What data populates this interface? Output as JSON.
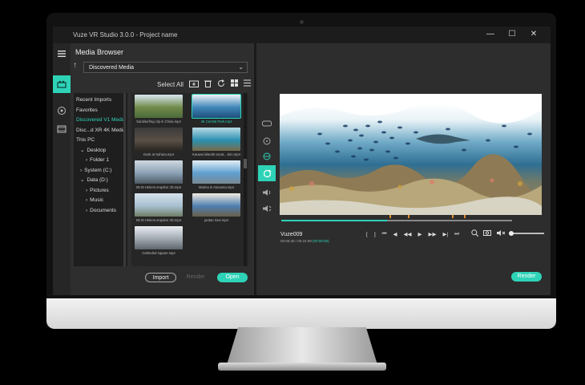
{
  "window": {
    "title": "Vuze VR Studio 3.0.0 - Project name",
    "controls": {
      "minimize": "—",
      "maximize": "☐",
      "close": "✕"
    }
  },
  "media_browser": {
    "title": "Media Browser",
    "source_select": "Discovered Media",
    "select_all": "Select All",
    "tree": [
      {
        "label": "Recent Imports",
        "level": 0,
        "selected": false
      },
      {
        "label": "Favorites",
        "level": 0,
        "selected": false
      },
      {
        "label": "Discovered V1 Media",
        "level": 0,
        "selected": true
      },
      {
        "label": "Disc...d XR 4K Media",
        "level": 0,
        "selected": false
      },
      {
        "label": "This PC",
        "level": 0,
        "selected": false
      },
      {
        "label": "Desktop",
        "level": 1,
        "selected": false,
        "toggle": "⌄"
      },
      {
        "label": "Folder 1",
        "level": 2,
        "selected": false,
        "toggle": "›"
      },
      {
        "label": "System (C:)",
        "level": 1,
        "selected": false,
        "toggle": "›"
      },
      {
        "label": "Data (D:)",
        "level": 1,
        "selected": false,
        "toggle": "⌄"
      },
      {
        "label": "Pictures",
        "level": 2,
        "selected": false,
        "toggle": "›"
      },
      {
        "label": "Music",
        "level": 2,
        "selected": false,
        "toggle": "›"
      },
      {
        "label": "Documents",
        "level": 2,
        "selected": false,
        "toggle": "›"
      }
    ],
    "thumbnails": [
      {
        "caption": "Sandsurfing city in China.mp4",
        "selected": false,
        "colors": [
          "#d9e6f0",
          "#6f8a4a",
          "#4c6a3a"
        ]
      },
      {
        "caption": "4K Central Park.mp4",
        "selected": true,
        "colors": [
          "#eef3f7",
          "#3f86b8",
          "#1d4f7a"
        ]
      },
      {
        "caption": "Dusk at Sahara.mp4",
        "selected": false,
        "colors": [
          "#3a3a3a",
          "#5a5046",
          "#2a2622"
        ]
      },
      {
        "caption": "Kauwai islands vacat....tion.mp4",
        "selected": false,
        "colors": [
          "#b9dbe6",
          "#2b8fb0",
          "#7a6a4a"
        ]
      },
      {
        "caption": "Mt St Helens eruption 3D.mp4",
        "selected": false,
        "colors": [
          "#cfd8e0",
          "#8aa0b4",
          "#4d5a63"
        ]
      },
      {
        "caption": "Marina in Atacama.mp4",
        "selected": false,
        "colors": [
          "#e2eef6",
          "#5f9fd0",
          "#7a8a92"
        ]
      },
      {
        "caption": "Mt St Helens eruption 3D.mp4",
        "selected": false,
        "colors": [
          "#d6e2ec",
          "#a7bfd0",
          "#6e7e66"
        ]
      },
      {
        "caption": "jordan river.mp4",
        "selected": false,
        "colors": [
          "#f1eadf",
          "#4f7fb0",
          "#6a5f4a"
        ]
      },
      {
        "caption": "Cathedral square.mp4",
        "selected": false,
        "colors": [
          "#e9eef2",
          "#a0a8b0",
          "#5e656c"
        ]
      }
    ],
    "buttons": {
      "import": "Import",
      "render": "Render",
      "open": "Open"
    }
  },
  "player": {
    "clip_name": "Vuze009",
    "time": "00:05:30 / 00:24:09",
    "time_alt": "(00:00:00)",
    "progress": 0.46,
    "markers": [
      0.47,
      0.55,
      0.74,
      0.79
    ],
    "volume": 0.0,
    "render_button": "Render",
    "controls": [
      "[",
      "]",
      "⏮",
      "◀◀",
      "◀",
      "▶",
      "▶▶",
      "⏭",
      "▶|"
    ]
  },
  "icons": {
    "menu": "hamburger-icon",
    "up": "arrow-up-icon"
  },
  "colors": {
    "accent": "#2ed3b7",
    "marker": "#e08a2a"
  }
}
